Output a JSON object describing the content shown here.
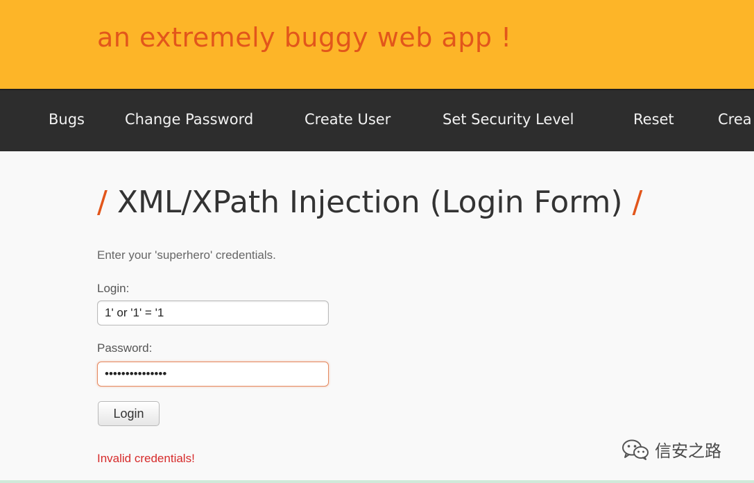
{
  "header": {
    "tagline": "an extremely buggy web app !"
  },
  "nav": {
    "items": [
      {
        "label": "Bugs"
      },
      {
        "label": "Change Password"
      },
      {
        "label": "Create User"
      },
      {
        "label": "Set Security Level"
      },
      {
        "label": "Reset"
      },
      {
        "label": "Crea"
      }
    ]
  },
  "page": {
    "title_slash": "/",
    "title": "XML/XPath Injection (Login Form)",
    "intro": "Enter your 'superhero' credentials.",
    "login_label": "Login:",
    "login_value": "1' or '1' = '1",
    "password_label": "Password:",
    "password_value": "•••••••••••••••",
    "login_button": "Login",
    "error": "Invalid credentials!"
  },
  "watermark": {
    "text": "信安之路",
    "icon": "wechat-icon"
  },
  "colors": {
    "header_bg": "#fdb528",
    "tagline": "#e2561b",
    "nav_bg": "#2d2d2d",
    "error": "#d62a2a"
  }
}
